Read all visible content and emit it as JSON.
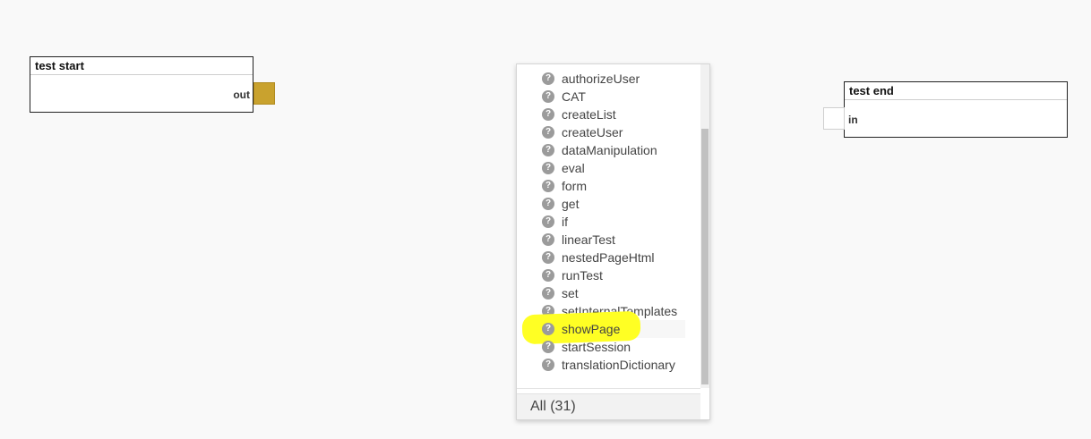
{
  "nodes": {
    "start": {
      "title": "test start",
      "port_label": "out"
    },
    "end": {
      "title": "test end",
      "port_label": "in"
    }
  },
  "colors": {
    "port_connected": "#c9a22e",
    "highlight": "#ffff24",
    "canvas": "#f9f9f9"
  },
  "dropdown": {
    "item_icon": "help-circle-icon",
    "item_icon_glyph": "?",
    "items": [
      "authorizeUser",
      "CAT",
      "createList",
      "createUser",
      "dataManipulation",
      "eval",
      "form",
      "get",
      "if",
      "linearTest",
      "nestedPageHtml",
      "runTest",
      "set",
      "setInternalTemplates",
      "showPage",
      "startSession",
      "translationDictionary"
    ],
    "selected_item": "showPage",
    "footer_label": "All (31)"
  }
}
